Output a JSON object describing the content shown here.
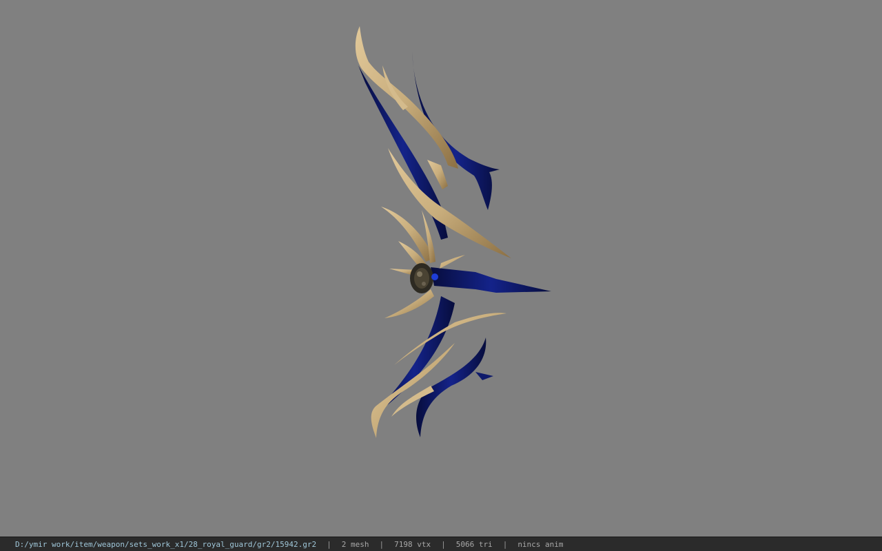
{
  "viewer": {
    "background_color": "#808080",
    "model_colors": {
      "gold": "#c8ad7c",
      "gold_dark": "#8b6f43",
      "blue": "#0e1a6b",
      "blue_dark": "#070d3d"
    }
  },
  "status": {
    "path": "D:/ymir work/item/weapon/sets_work_x1/28_royal_guard/gr2/15942.gr2",
    "separator": "|",
    "mesh": "2 mesh",
    "vtx": "7198 vtx",
    "tri": "5066 tri",
    "anim": "nincs anim"
  }
}
